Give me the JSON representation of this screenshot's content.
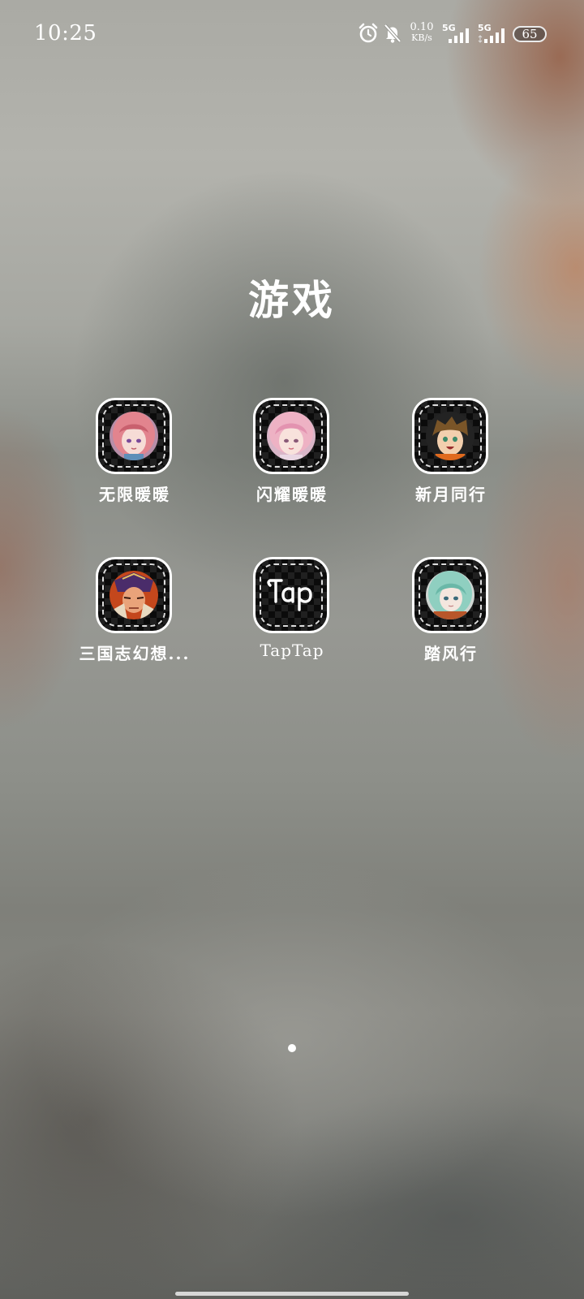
{
  "status_bar": {
    "time": "10:25",
    "icons": [
      "alarm-icon",
      "bell-off-icon"
    ],
    "net_speed_value": "0.10",
    "net_speed_unit": "KB/s",
    "sim1_label": "5G",
    "sim2_label": "5G",
    "battery_level": "65"
  },
  "folder": {
    "title": "游戏",
    "apps": [
      {
        "label": "无限暖暖",
        "icon": "pink-hair-girl-icon"
      },
      {
        "label": "闪耀暖暖",
        "icon": "pink-hair-girl-icon"
      },
      {
        "label": "新月同行",
        "icon": "brown-hair-boy-icon"
      },
      {
        "label": "三国志幻想...",
        "icon": "armored-general-icon"
      },
      {
        "label": "TapTap",
        "icon": "taptap-logo-icon"
      },
      {
        "label": "踏风行",
        "icon": "teal-hair-girl-icon"
      }
    ]
  },
  "pager": {
    "page_count": 1,
    "current_page": 1
  },
  "colors": {
    "text": "#ffffff",
    "icon_background": "#0b0b0b"
  }
}
